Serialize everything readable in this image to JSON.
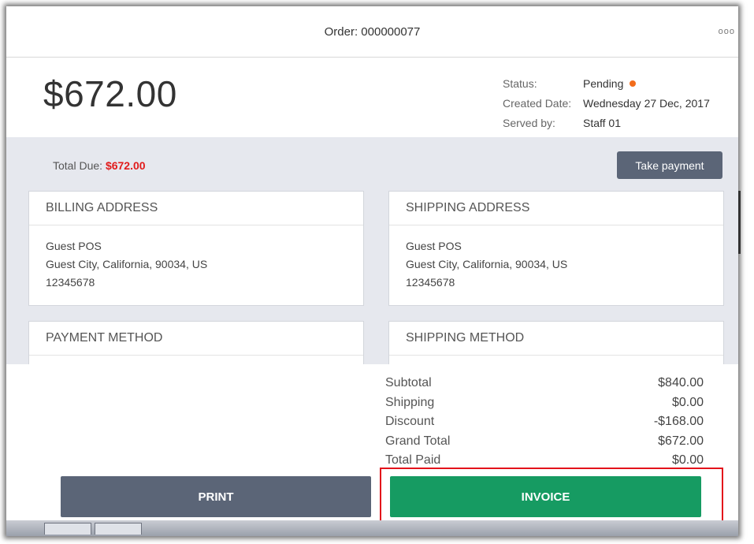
{
  "header": {
    "order_title": "Order: 000000077",
    "more_icon": "ooo"
  },
  "summary": {
    "amount": "$672.00",
    "status_label": "Status:",
    "status_value": "Pending",
    "status_color": "#f26c1b",
    "created_label": "Created Date:",
    "created_value": "Wednesday 27 Dec, 2017",
    "served_label": "Served by:",
    "served_value": "Staff 01"
  },
  "due": {
    "label": "Total Due:",
    "value": "$672.00",
    "take_payment_label": "Take payment"
  },
  "billing": {
    "title": "BILLING ADDRESS",
    "name": "Guest POS",
    "address": "Guest City, California, 90034, US",
    "phone": "12345678"
  },
  "shipping": {
    "title": "SHIPPING ADDRESS",
    "name": "Guest POS",
    "address": "Guest City, California, 90034, US",
    "phone": "12345678"
  },
  "payment_method": {
    "title": "PAYMENT METHOD"
  },
  "shipping_method": {
    "title": "SHIPPING METHOD"
  },
  "totals": [
    {
      "label": "Subtotal",
      "value": "$840.00"
    },
    {
      "label": "Shipping",
      "value": "$0.00"
    },
    {
      "label": "Discount",
      "value": "-$168.00"
    },
    {
      "label": "Grand Total",
      "value": "$672.00"
    },
    {
      "label": "Total Paid",
      "value": "$0.00"
    }
  ],
  "actions": {
    "print_label": "PRINT",
    "invoice_label": "INVOICE",
    "print_color": "#5b6577",
    "invoice_color": "#169b62",
    "highlight_color": "#e3131b"
  }
}
